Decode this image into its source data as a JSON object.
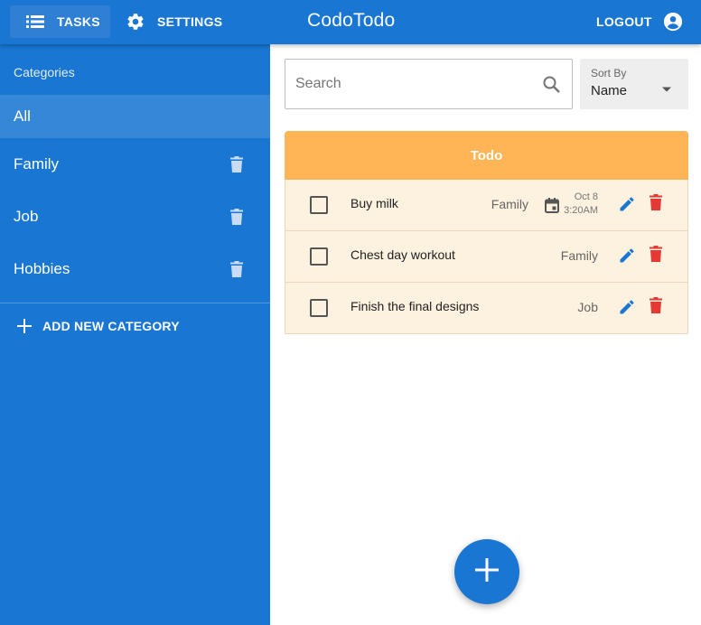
{
  "nav": {
    "tasks_label": "TASKS",
    "settings_label": "SETTINGS",
    "app_title": "CodoTodo",
    "logout_label": "LOGOUT"
  },
  "sidebar": {
    "header": "Categories",
    "items": [
      {
        "label": "All",
        "active": true
      },
      {
        "label": "Family"
      },
      {
        "label": "Job"
      },
      {
        "label": "Hobbies"
      }
    ],
    "add_label": "ADD NEW CATEGORY"
  },
  "search": {
    "placeholder": "Search",
    "value": ""
  },
  "sort": {
    "label": "Sort By",
    "value": "Name"
  },
  "list": {
    "header": "Todo",
    "rows": [
      {
        "task": "Buy milk",
        "category": "Family",
        "date": "Oct 8",
        "time": "3:20AM"
      },
      {
        "task": "Chest day workout",
        "category": "Family"
      },
      {
        "task": "Finish the final designs",
        "category": "Job"
      }
    ]
  },
  "colors": {
    "primary": "#1976d2",
    "todo_header": "#ffb555",
    "row_bg": "#fdf1df",
    "edit_icon": "#1976d2",
    "delete_icon": "#e53935"
  },
  "icons": [
    "list-icon",
    "gear-icon",
    "account-circle-icon",
    "trash-icon",
    "plus-icon",
    "search-icon",
    "dropdown-caret-icon",
    "calendar-icon",
    "pencil-icon"
  ]
}
